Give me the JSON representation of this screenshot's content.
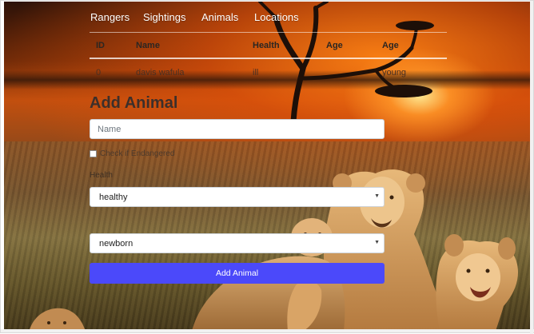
{
  "nav": {
    "links": [
      {
        "label": "Rangers"
      },
      {
        "label": "Sightings"
      },
      {
        "label": "Animals"
      },
      {
        "label": "Locations"
      }
    ]
  },
  "table": {
    "headers": [
      "ID",
      "Name",
      "Health",
      "Age",
      "Age"
    ],
    "rows": [
      {
        "id": "0",
        "name": "davis wafula",
        "health": "ill",
        "age": "young"
      }
    ]
  },
  "form": {
    "title": "Add Animal",
    "name_placeholder": "Name",
    "endangered_label": "Check if Endangered",
    "health_label": "Health",
    "health_selected": "healthy",
    "age_selected": "newborn",
    "submit_label": "Add Animal"
  },
  "background": {
    "icons": [
      "acacia-tree-icon",
      "lion-family-icon"
    ]
  }
}
